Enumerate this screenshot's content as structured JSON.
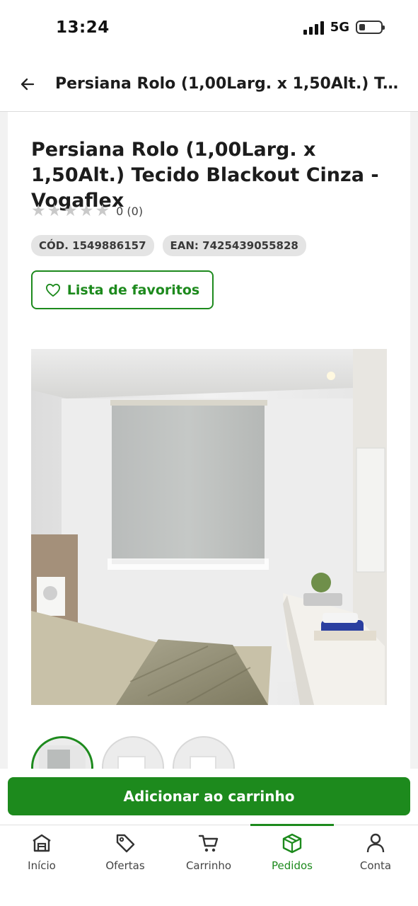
{
  "status_bar": {
    "time": "13:24",
    "network": "5G"
  },
  "header": {
    "title": "Persiana Rolo (1,00Larg. x 1,50Alt.) Tecido Blackout Cinza - Vogaflex"
  },
  "product": {
    "title": "Persiana Rolo (1,00Larg. x 1,50Alt.) Tecido Blackout Cinza - Vogaflex",
    "rating_text": "0 (0)",
    "stars_filled": 0,
    "stars_total": 5,
    "code": "CÓD. 1549886157",
    "ean": "EAN: 7425439055828",
    "favorites_label": "Lista de favoritos",
    "image_icon": "roller-blind-room-photo",
    "thumbnail_count": 3,
    "thumbnail_selected": 1
  },
  "cart": {
    "add_label": "Adicionar ao carrinho"
  },
  "nav": {
    "items": [
      {
        "label": "Início",
        "icon": "home-icon"
      },
      {
        "label": "Ofertas",
        "icon": "tag-icon"
      },
      {
        "label": "Carrinho",
        "icon": "cart-icon"
      },
      {
        "label": "Pedidos",
        "icon": "box-icon"
      },
      {
        "label": "Conta",
        "icon": "user-icon"
      }
    ],
    "active": "Pedidos"
  },
  "colors": {
    "brand_green": "#1d8a1d",
    "star_empty": "#c9c9c9",
    "pill_bg": "#e4e4e4"
  }
}
